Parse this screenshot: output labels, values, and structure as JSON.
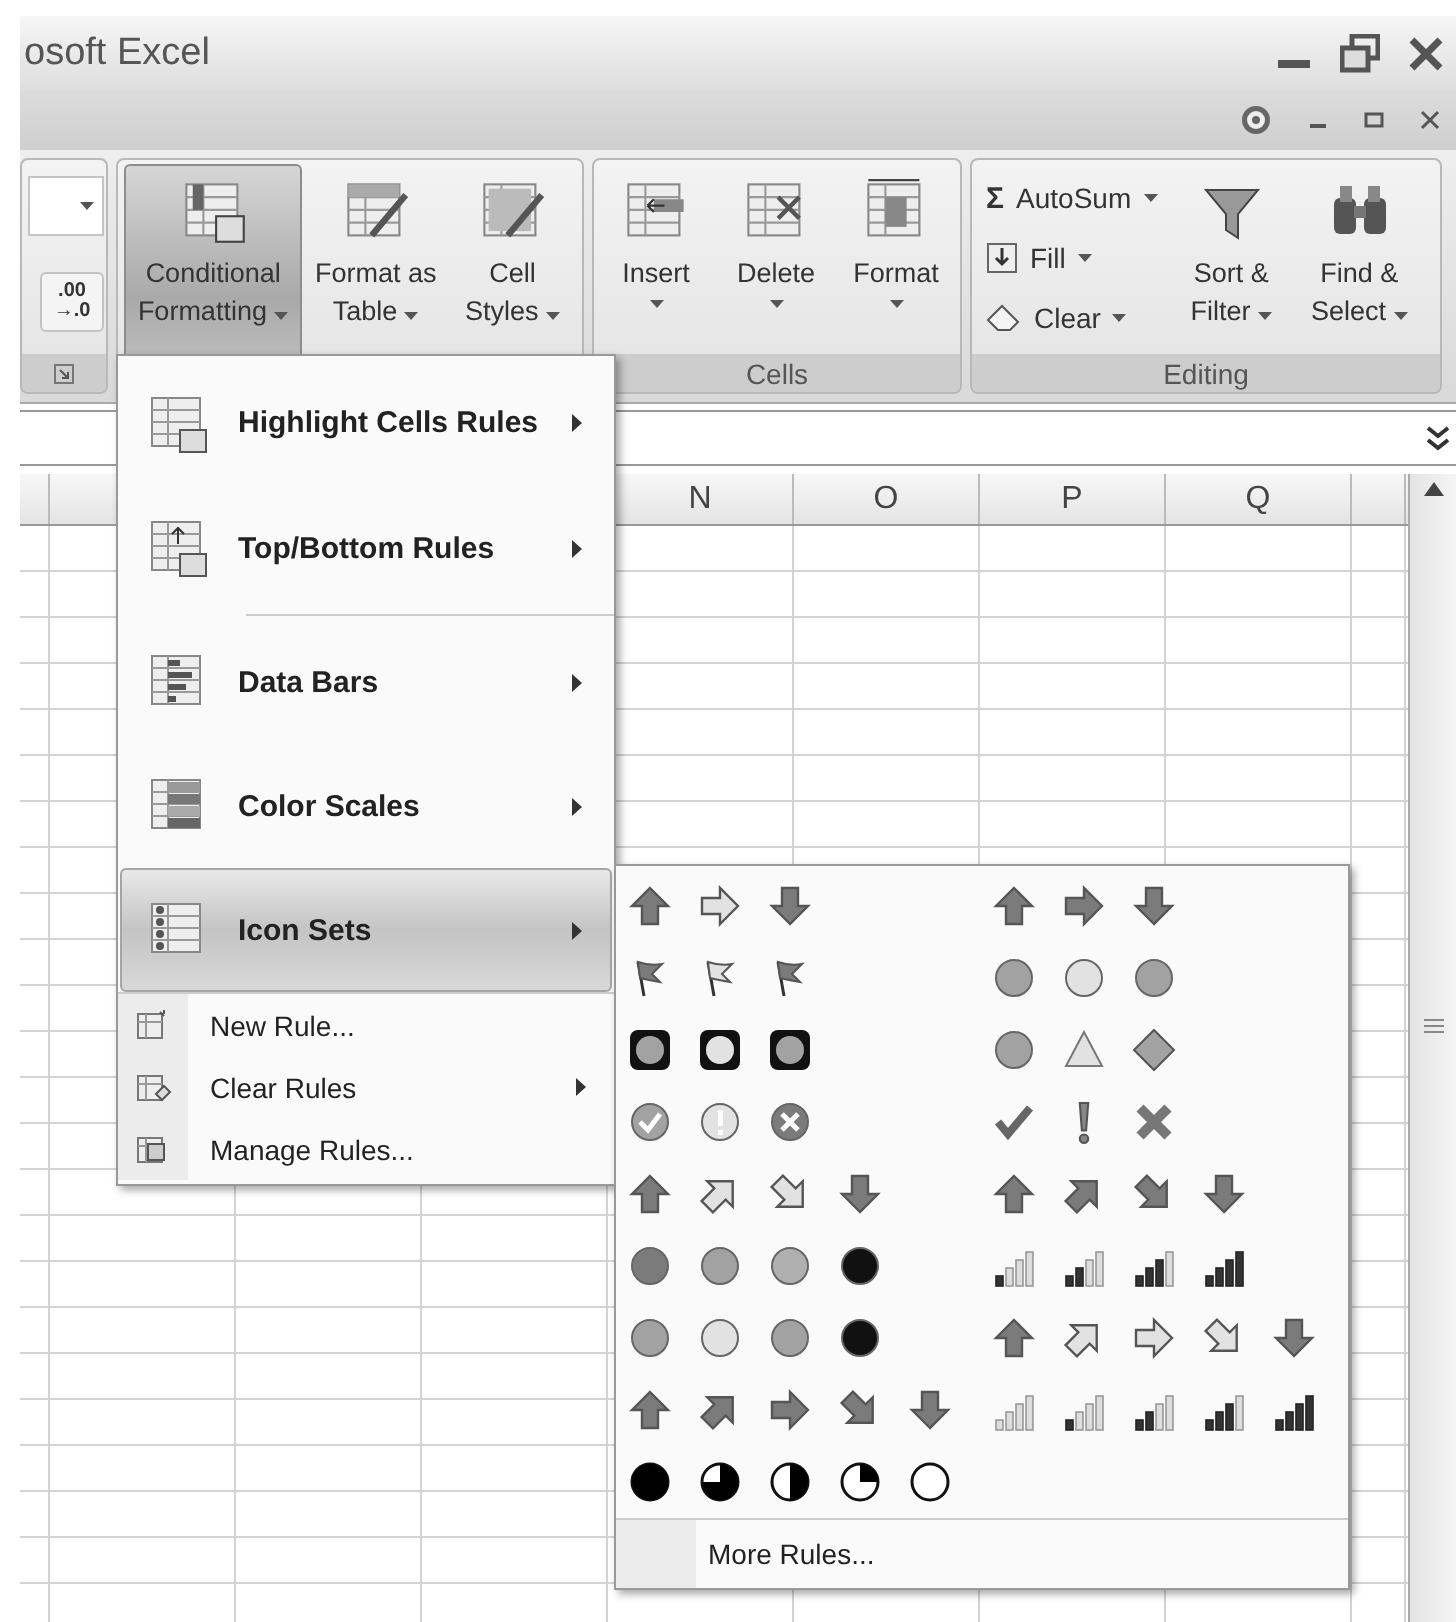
{
  "window": {
    "title": "osoft Excel"
  },
  "ribbon": {
    "number_group": {
      "decimal_button": [
        ".00",
        "→.0"
      ]
    },
    "styles_group": {
      "buttons": [
        {
          "kind": "conditional",
          "lines": [
            "Conditional",
            "Formatting"
          ],
          "selected": true
        },
        {
          "kind": "table",
          "lines": [
            "Format as",
            "Table"
          ],
          "selected": false
        },
        {
          "kind": "styles",
          "lines": [
            "Cell",
            "Styles"
          ],
          "selected": false
        }
      ]
    },
    "cells_group": {
      "label": "Cells",
      "buttons": [
        {
          "kind": "insert",
          "label": "Insert"
        },
        {
          "kind": "delete",
          "label": "Delete"
        },
        {
          "kind": "format",
          "label": "Format"
        }
      ]
    },
    "editing_group": {
      "label": "Editing",
      "small_buttons": [
        {
          "kind": "sum",
          "icon": "Σ",
          "label": "AutoSum"
        },
        {
          "kind": "fill",
          "label": "Fill"
        },
        {
          "kind": "clear",
          "label": "Clear"
        }
      ],
      "buttons": [
        {
          "kind": "sort",
          "lines": [
            "Sort &",
            "Filter"
          ]
        },
        {
          "kind": "find",
          "lines": [
            "Find &",
            "Select"
          ]
        }
      ]
    }
  },
  "sheet": {
    "columns": [
      "N",
      "O",
      "P",
      "Q"
    ]
  },
  "menu": {
    "items": [
      {
        "kind": "large",
        "label": "Highlight Cells Rules",
        "submenu": true,
        "selected": false
      },
      {
        "kind": "large",
        "label": "Top/Bottom Rules",
        "submenu": true,
        "selected": false
      },
      {
        "kind": "separator"
      },
      {
        "kind": "large",
        "label": "Data Bars",
        "submenu": true,
        "selected": false
      },
      {
        "kind": "large",
        "label": "Color Scales",
        "submenu": true,
        "selected": false
      },
      {
        "kind": "large",
        "label": "Icon Sets",
        "submenu": true,
        "selected": true
      },
      {
        "kind": "small",
        "label": "New Rule...",
        "submenu": false,
        "selected": false
      },
      {
        "kind": "small",
        "label": "Clear Rules",
        "submenu": true,
        "selected": false
      },
      {
        "kind": "small",
        "label": "Manage Rules...",
        "submenu": false,
        "selected": false
      }
    ]
  },
  "submenu": {
    "icon_sets": [
      {
        "kind": "arrows3-grey"
      },
      {
        "kind": "arrows3"
      },
      {
        "kind": "flags3"
      },
      {
        "kind": "circles3"
      },
      {
        "kind": "lights3-rimmed"
      },
      {
        "kind": "signs3"
      },
      {
        "kind": "symbols3-circled"
      },
      {
        "kind": "symbols3"
      },
      {
        "kind": "arrows4-grey"
      },
      {
        "kind": "arrows4"
      },
      {
        "kind": "redtoblack4"
      },
      {
        "kind": "rating4"
      },
      {
        "kind": "lights4"
      },
      {
        "kind": "arrows5-grey"
      },
      {
        "kind": "arrows5"
      },
      {
        "kind": "rating5"
      },
      {
        "kind": "quarters5"
      }
    ],
    "footer": "More Rules..."
  }
}
